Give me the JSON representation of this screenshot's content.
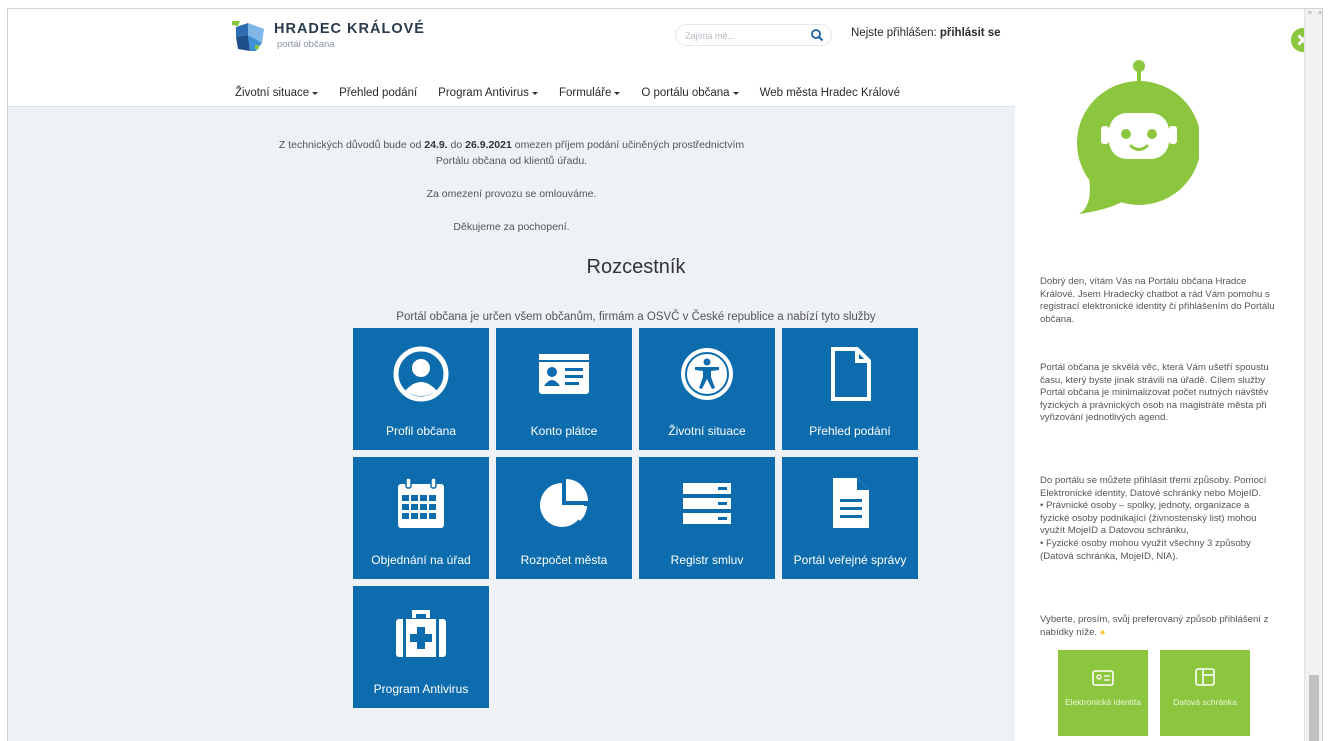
{
  "header": {
    "logo_title": "HRADEC KRÁLOVÉ",
    "logo_subtitle": "portál občana",
    "search_placeholder": "Zajímá mě...",
    "login_prefix": "Nejste přihlášen:",
    "login_link": "přihlásit se"
  },
  "nav": {
    "items": [
      {
        "label": "Životní situace",
        "dropdown": true
      },
      {
        "label": "Přehled podání",
        "dropdown": false
      },
      {
        "label": "Program Antivirus",
        "dropdown": true
      },
      {
        "label": "Formuláře",
        "dropdown": true
      },
      {
        "label": "O portálu občana",
        "dropdown": true
      },
      {
        "label": "Web města Hradec Králové",
        "dropdown": false
      }
    ]
  },
  "notice": {
    "part1": "Z technických důvodů bude od ",
    "date_from": "24.9.",
    "part2": " do ",
    "date_to": "26.9.2021",
    "part3": " omezen příjem podání učiněných prostřednictvím",
    "line2": "Portálu občana od klientů úřadu.",
    "apology": "Za omezení provozu se omlouváme.",
    "thanks": "Děkujeme za pochopení."
  },
  "main": {
    "heading": "Rozcestník",
    "intro": "Portál občana je určen všem občanům, firmám a OSVČ v České republice a nabízí tyto služby",
    "tiles": [
      {
        "label": "Profil občana",
        "icon": "user-circle-icon"
      },
      {
        "label": "Konto plátce",
        "icon": "id-card-icon"
      },
      {
        "label": "Životní situace",
        "icon": "accessibility-icon"
      },
      {
        "label": "Přehled podání",
        "icon": "document-outline-icon"
      },
      {
        "label": "Objednání na úřad",
        "icon": "calendar-icon"
      },
      {
        "label": "Rozpočet města",
        "icon": "pie-chart-icon"
      },
      {
        "label": "Registr smluv",
        "icon": "server-icon"
      },
      {
        "label": "Portál veřejné správy",
        "icon": "file-text-icon"
      },
      {
        "label": "Program Antivirus",
        "icon": "medical-kit-icon"
      }
    ]
  },
  "chat": {
    "msg1": "Dobrý den, vítám Vás na Portálu občana Hradce Králové. Jsem Hradecký chatbot a rád Vám pomohu s registrací elektronické identity či přihlášením do Portálu občana.",
    "msg2": "Portál občana je skvělá věc, která Vám ušetří spoustu času, který byste jinak strávili na úřadě. Cílem služby Portál občana je minimalizovat počet nutných návštěv fyzických a právnických osob na magistráte města při vyřizování jednotlivých agend.",
    "msg3_intro": "Do portálu se můžete přihlásit třemi způsoby. Pomocí Elektronické identity, Datové schránky nebo MojeID.",
    "msg3_bullet1": "• Právnické osoby – spolky, jednoty, organizace a fyzické osoby podnikající (živnostenský list) mohou využít MojeID a Datovou schránku,",
    "msg3_bullet2": "• Fyzické osoby mohou využít všechny 3 způsoby (Datová schránka, MojeID, NIA).",
    "msg4": "Vyberte, prosím, svůj preferovaný způsob přihlášení z nabídky níže.",
    "btn1": "Elektronická identita",
    "btn2": "Datová schránka"
  },
  "colors": {
    "tile_blue": "#0d6cad",
    "chat_green": "#8cc63e",
    "page_bg": "#eef2f6"
  }
}
